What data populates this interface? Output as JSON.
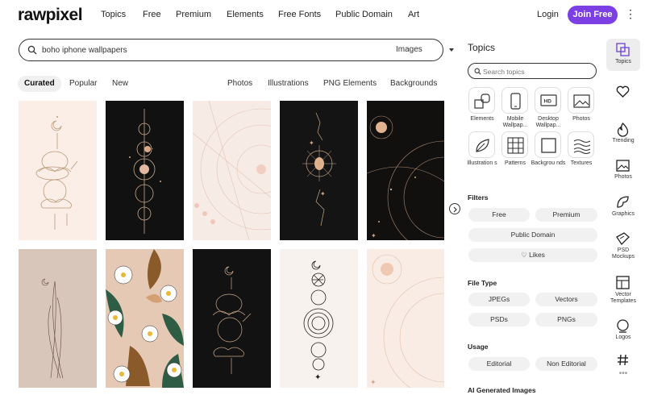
{
  "brand": {
    "logo": "rawpixel",
    "accent": "#7b3fe4"
  },
  "nav": {
    "links": [
      "Topics",
      "Free",
      "Premium",
      "Elements",
      "Free Fonts",
      "Public Domain",
      "Art"
    ],
    "login": "Login",
    "join": "Join Free"
  },
  "search": {
    "value": "boho iphone wallpapers",
    "type": "Images"
  },
  "tabs": {
    "sort": [
      "Curated",
      "Popular",
      "New"
    ],
    "categories": [
      "Photos",
      "Illustrations",
      "PNG Elements",
      "Backgrounds"
    ]
  },
  "panel": {
    "title": "Topics",
    "search_placeholder": "Search topics",
    "topics": [
      {
        "label": "Elements",
        "icon": "elements-icon"
      },
      {
        "label": "Mobile Wallpap...",
        "icon": "mobile-icon"
      },
      {
        "label": "Desktop Wallpap...",
        "icon": "desktop-icon"
      },
      {
        "label": "Photos",
        "icon": "photo-icon"
      },
      {
        "label": "Illustration s",
        "icon": "leaf-icon"
      },
      {
        "label": "Patterns",
        "icon": "grid-icon"
      },
      {
        "label": "Backgrou nds",
        "icon": "square-icon"
      },
      {
        "label": "Textures",
        "icon": "waves-icon"
      }
    ],
    "filters_title": "Filters",
    "filters": {
      "free": "Free",
      "premium": "Premium",
      "public_domain": "Public Domain",
      "likes": "Likes"
    },
    "filetype_title": "File Type",
    "filetypes": [
      "JPEGs",
      "Vectors",
      "PSDs",
      "PNGs"
    ],
    "usage_title": "Usage",
    "usage": [
      "Editorial",
      "Non Editorial"
    ],
    "ai_title": "AI Generated Images"
  },
  "rail": [
    {
      "label": "Topics",
      "icon": "topics-icon"
    },
    {
      "label": "",
      "icon": "heart-icon"
    },
    {
      "label": "Trending",
      "icon": "flame-icon"
    },
    {
      "label": "Photos",
      "icon": "image-icon"
    },
    {
      "label": "Graphics",
      "icon": "graphics-icon"
    },
    {
      "label": "PSD Mockups",
      "icon": "psd-icon"
    },
    {
      "label": "Vector Templates",
      "icon": "template-icon"
    },
    {
      "label": "Logos",
      "icon": "logo-icon"
    },
    {
      "label": "",
      "icon": "hashtag-icon"
    }
  ]
}
